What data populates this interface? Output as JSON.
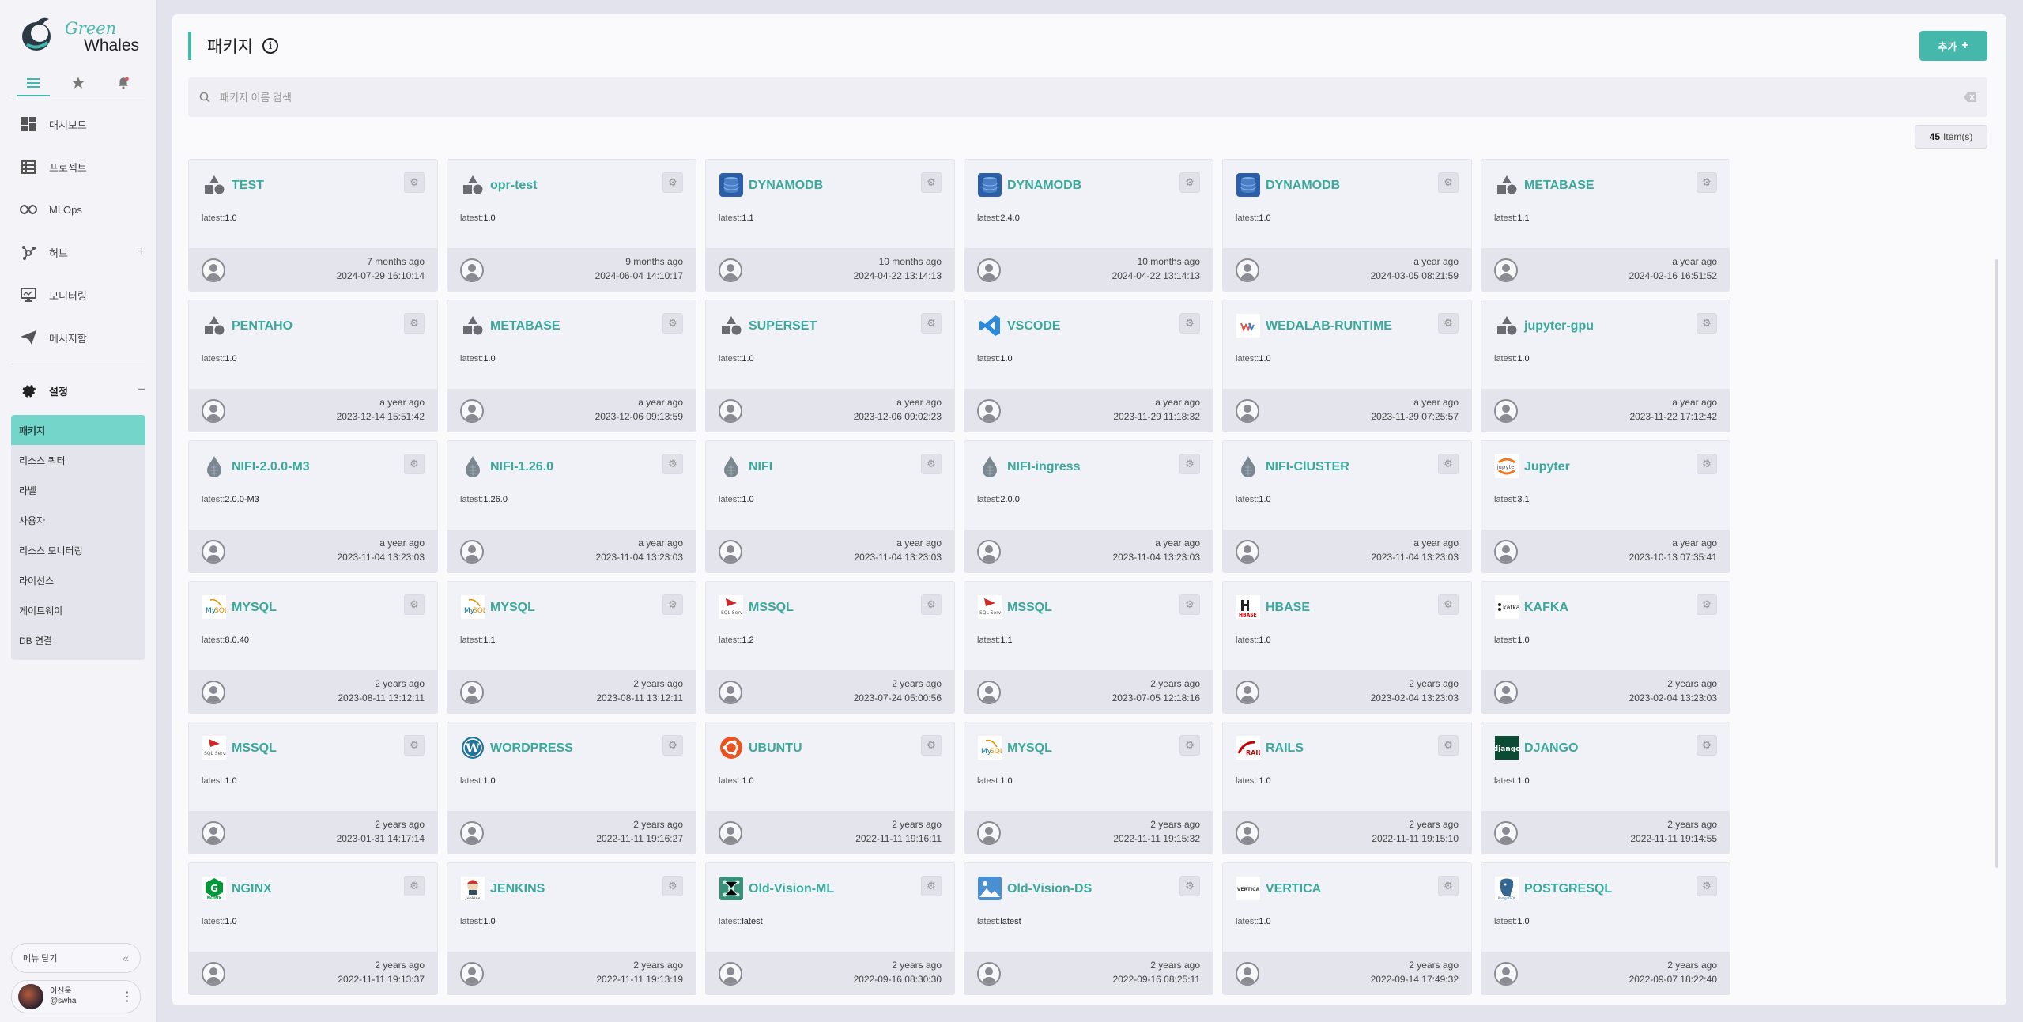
{
  "brand": {
    "line1": "Green",
    "line2": "Whales"
  },
  "sidebar": {
    "tabs": [
      {
        "icon": "menu-icon"
      },
      {
        "icon": "star-icon"
      },
      {
        "icon": "bell-icon"
      }
    ],
    "nav": [
      {
        "label": "대시보드",
        "icon": "dashboard-icon"
      },
      {
        "label": "프로젝트",
        "icon": "project-list-icon"
      },
      {
        "label": "MLOps",
        "icon": "infinity-icon"
      },
      {
        "label": "허브",
        "icon": "hub-icon",
        "toggle": "+"
      },
      {
        "label": "모니터링",
        "icon": "monitor-icon"
      },
      {
        "label": "메시지함",
        "icon": "send-icon"
      }
    ],
    "settings": {
      "label": "설정",
      "toggle": "−"
    },
    "sub_items": [
      "패키지",
      "리소스 쿼터",
      "라벨",
      "사용자",
      "리소스 모니터링",
      "라이선스",
      "게이트웨이",
      "DB 연결"
    ],
    "collapse_label": "메뉴 닫기",
    "user": {
      "name": "이신욱",
      "handle": "@swha"
    }
  },
  "header": {
    "title": "패키지",
    "add_label": "추가"
  },
  "search": {
    "placeholder": "패키지 이름 검색"
  },
  "count": {
    "value": "45",
    "suffix": "Item(s)"
  },
  "accent": "#45b7ab",
  "packages": [
    {
      "name": "TEST",
      "tag_prefix": "latest:",
      "tag": "1.0",
      "ago": "7 months ago",
      "date": "2024-07-29 16:10:14",
      "icon": "generic"
    },
    {
      "name": "opr-test",
      "tag_prefix": "latest:",
      "tag": "1.0",
      "ago": "9 months ago",
      "date": "2024-06-04 14:10:17",
      "icon": "generic"
    },
    {
      "name": "DYNAMODB",
      "tag_prefix": "latest:",
      "tag": "1.1",
      "ago": "10 months ago",
      "date": "2024-04-22 13:14:13",
      "icon": "db"
    },
    {
      "name": "DYNAMODB",
      "tag_prefix": "latest:",
      "tag": "2.4.0",
      "ago": "10 months ago",
      "date": "2024-04-22 13:14:13",
      "icon": "db"
    },
    {
      "name": "DYNAMODB",
      "tag_prefix": "latest:",
      "tag": "1.0",
      "ago": "a year ago",
      "date": "2024-03-05 08:21:59",
      "icon": "db"
    },
    {
      "name": "METABASE",
      "tag_prefix": "latest:",
      "tag": "1.1",
      "ago": "a year ago",
      "date": "2024-02-16 16:51:52",
      "icon": "generic"
    },
    {
      "name": "PENTAHO",
      "tag_prefix": "latest:",
      "tag": "1.0",
      "ago": "a year ago",
      "date": "2023-12-14 15:51:42",
      "icon": "generic"
    },
    {
      "name": "METABASE",
      "tag_prefix": "latest:",
      "tag": "1.0",
      "ago": "a year ago",
      "date": "2023-12-06 09:13:59",
      "icon": "generic"
    },
    {
      "name": "SUPERSET",
      "tag_prefix": "latest:",
      "tag": "1.0",
      "ago": "a year ago",
      "date": "2023-12-06 09:02:23",
      "icon": "generic"
    },
    {
      "name": "VSCODE",
      "tag_prefix": "latest:",
      "tag": "1.0",
      "ago": "a year ago",
      "date": "2023-11-29 11:18:32",
      "icon": "vscode"
    },
    {
      "name": "WEDALAB-RUNTIME",
      "tag_prefix": "latest:",
      "tag": "1.0",
      "ago": "a year ago",
      "date": "2023-11-29 07:25:57",
      "icon": "wedalab"
    },
    {
      "name": "jupyter-gpu",
      "tag_prefix": "latest:",
      "tag": "1.0",
      "ago": "a year ago",
      "date": "2023-11-22 17:12:42",
      "icon": "generic"
    },
    {
      "name": "NIFI-2.0.0-M3",
      "tag_prefix": "latest:",
      "tag": "2.0.0-M3",
      "ago": "a year ago",
      "date": "2023-11-04 13:23:03",
      "icon": "nifi"
    },
    {
      "name": "NIFI-1.26.0",
      "tag_prefix": "latest:",
      "tag": "1.26.0",
      "ago": "a year ago",
      "date": "2023-11-04 13:23:03",
      "icon": "nifi"
    },
    {
      "name": "NIFI",
      "tag_prefix": "latest:",
      "tag": "1.0",
      "ago": "a year ago",
      "date": "2023-11-04 13:23:03",
      "icon": "nifi"
    },
    {
      "name": "NIFI-ingress",
      "tag_prefix": "latest:",
      "tag": "2.0.0",
      "ago": "a year ago",
      "date": "2023-11-04 13:23:03",
      "icon": "nifi"
    },
    {
      "name": "NIFI-ClUSTER",
      "tag_prefix": "latest:",
      "tag": "1.0",
      "ago": "a year ago",
      "date": "2023-11-04 13:23:03",
      "icon": "nifi"
    },
    {
      "name": "Jupyter",
      "tag_prefix": "latest:",
      "tag": "3.1",
      "ago": "a year ago",
      "date": "2023-10-13 07:35:41",
      "icon": "jupyter"
    },
    {
      "name": "MYSQL",
      "tag_prefix": "latest:",
      "tag": "8.0.40",
      "ago": "2 years ago",
      "date": "2023-08-11 13:12:11",
      "icon": "mysql"
    },
    {
      "name": "MYSQL",
      "tag_prefix": "latest:",
      "tag": "1.1",
      "ago": "2 years ago",
      "date": "2023-08-11 13:12:11",
      "icon": "mysql"
    },
    {
      "name": "MSSQL",
      "tag_prefix": "latest:",
      "tag": "1.2",
      "ago": "2 years ago",
      "date": "2023-07-24 05:00:56",
      "icon": "mssql"
    },
    {
      "name": "MSSQL",
      "tag_prefix": "latest:",
      "tag": "1.1",
      "ago": "2 years ago",
      "date": "2023-07-05 12:18:16",
      "icon": "mssql"
    },
    {
      "name": "HBASE",
      "tag_prefix": "latest:",
      "tag": "1.0",
      "ago": "2 years ago",
      "date": "2023-02-04 13:23:03",
      "icon": "hbase"
    },
    {
      "name": "KAFKA",
      "tag_prefix": "latest:",
      "tag": "1.0",
      "ago": "2 years ago",
      "date": "2023-02-04 13:23:03",
      "icon": "kafka"
    },
    {
      "name": "MSSQL",
      "tag_prefix": "latest:",
      "tag": "1.0",
      "ago": "2 years ago",
      "date": "2023-01-31 14:17:14",
      "icon": "mssql"
    },
    {
      "name": "WORDPRESS",
      "tag_prefix": "latest:",
      "tag": "1.0",
      "ago": "2 years ago",
      "date": "2022-11-11 19:16:27",
      "icon": "wordpress"
    },
    {
      "name": "UBUNTU",
      "tag_prefix": "latest:",
      "tag": "1.0",
      "ago": "2 years ago",
      "date": "2022-11-11 19:16:11",
      "icon": "ubuntu"
    },
    {
      "name": "MYSQL",
      "tag_prefix": "latest:",
      "tag": "1.0",
      "ago": "2 years ago",
      "date": "2022-11-11 19:15:32",
      "icon": "mysql"
    },
    {
      "name": "RAILS",
      "tag_prefix": "latest:",
      "tag": "1.0",
      "ago": "2 years ago",
      "date": "2022-11-11 19:15:10",
      "icon": "rails"
    },
    {
      "name": "DJANGO",
      "tag_prefix": "latest:",
      "tag": "1.0",
      "ago": "2 years ago",
      "date": "2022-11-11 19:14:55",
      "icon": "django"
    },
    {
      "name": "NGINX",
      "tag_prefix": "latest:",
      "tag": "1.0",
      "ago": "2 years ago",
      "date": "2022-11-11 19:13:37",
      "icon": "nginx"
    },
    {
      "name": "JENKINS",
      "tag_prefix": "latest:",
      "tag": "1.0",
      "ago": "2 years ago",
      "date": "2022-11-11 19:13:19",
      "icon": "jenkins"
    },
    {
      "name": "Old-Vision-ML",
      "tag_prefix": "latest:",
      "tag": "latest",
      "ago": "2 years ago",
      "date": "2022-09-16 08:30:30",
      "icon": "vision-ml"
    },
    {
      "name": "Old-Vision-DS",
      "tag_prefix": "latest:",
      "tag": "latest",
      "ago": "2 years ago",
      "date": "2022-09-16 08:25:11",
      "icon": "vision-ds"
    },
    {
      "name": "VERTICA",
      "tag_prefix": "latest:",
      "tag": "1.0",
      "ago": "2 years ago",
      "date": "2022-09-14 17:49:32",
      "icon": "vertica"
    },
    {
      "name": "POSTGRESQL",
      "tag_prefix": "latest:",
      "tag": "1.0",
      "ago": "2 years ago",
      "date": "2022-09-07 18:22:40",
      "icon": "postgresql"
    }
  ]
}
